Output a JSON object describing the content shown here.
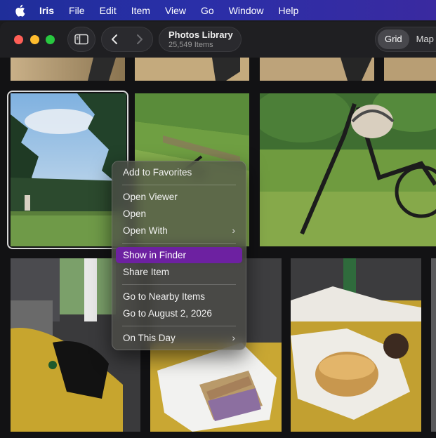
{
  "menubar": {
    "app_name": "Iris",
    "items": [
      "File",
      "Edit",
      "Item",
      "View",
      "Go",
      "Window",
      "Help"
    ]
  },
  "toolbar": {
    "title": "Photos Library",
    "subtitle": "25,549 Items",
    "view_modes": [
      "Grid",
      "Map"
    ],
    "active_view": "Grid"
  },
  "context_menu": {
    "items": [
      {
        "label": "Add to Favorites"
      },
      {
        "label": "Open Viewer"
      },
      {
        "label": "Open"
      },
      {
        "label": "Open With"
      },
      {
        "label": "Show in Finder"
      },
      {
        "label": "Share Item"
      },
      {
        "label": "Go to Nearby Items"
      },
      {
        "label": "Go to August 2, 2026"
      },
      {
        "label": "On This Day"
      }
    ],
    "highlighted": "Show in Finder"
  },
  "colors": {
    "menu_highlight": "#6d21a1",
    "menubar_bg": "#2a2fa8"
  },
  "photos": [
    {
      "subject": "grass"
    },
    {
      "subject": "grass"
    },
    {
      "subject": "grass"
    },
    {
      "subject": "grass"
    },
    {
      "subject": "trees-sky"
    },
    {
      "subject": "park-lawn"
    },
    {
      "subject": "bicycle"
    },
    {
      "subject": "dog-table"
    },
    {
      "subject": "cake-box"
    },
    {
      "subject": "sandwich-box"
    },
    {
      "subject": "edge"
    }
  ]
}
